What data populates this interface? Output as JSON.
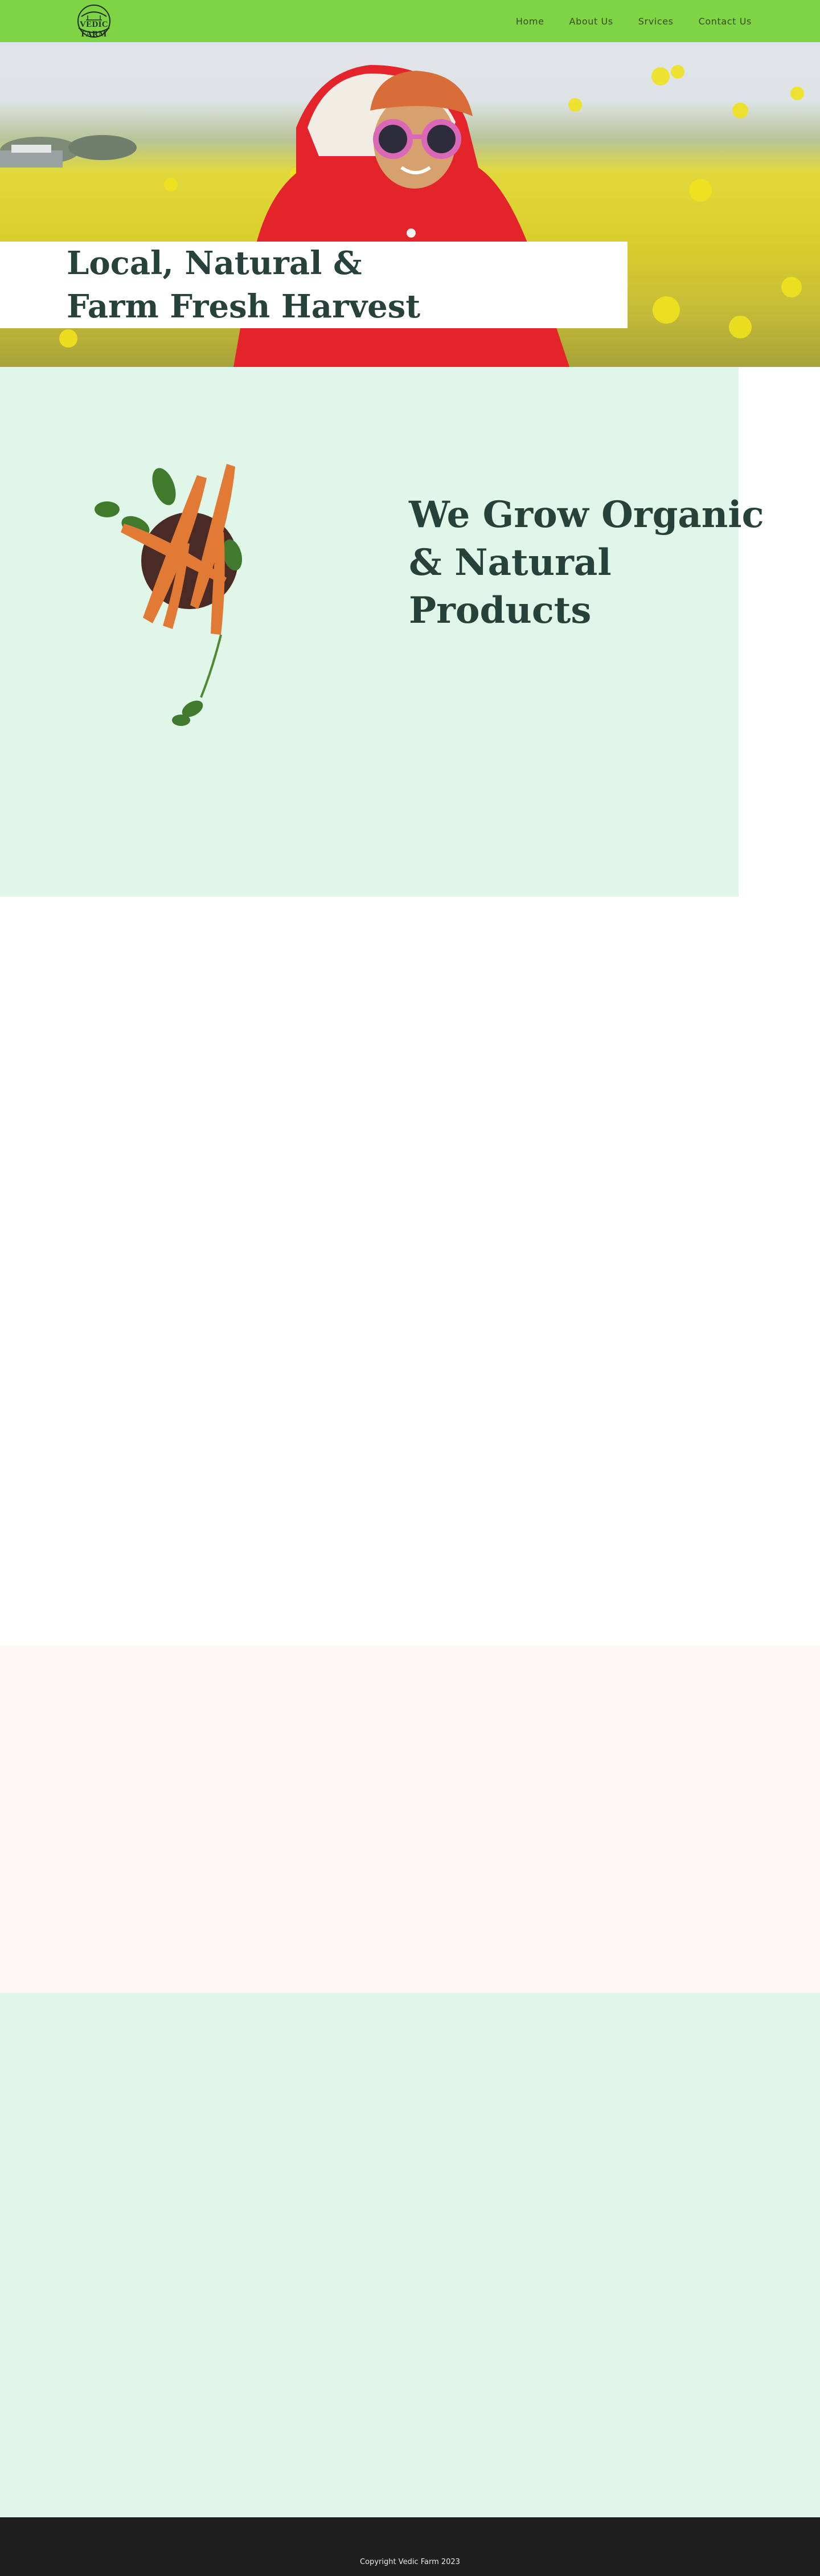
{
  "header": {
    "logo_text": "VEDIC FARM",
    "nav": [
      "Home",
      "About Us",
      "Srvices",
      "Contact Us"
    ],
    "bg_color": "#7ed442"
  },
  "hero": {
    "title": "Local, Natural &\nFarm Fresh Harvest",
    "image": "girl-in-mustard-field"
  },
  "organic": {
    "title": "We Grow Organic\n& Natural Products",
    "image": "carrots-bowl",
    "bg_color": "#e0f6e8"
  },
  "footer": {
    "copyright": "Copyright Vedic Farm 2023"
  },
  "colors": {
    "heading": "#27423a",
    "peach_bg": "#fdf7f3",
    "footer_bg": "#1f1f1f"
  }
}
